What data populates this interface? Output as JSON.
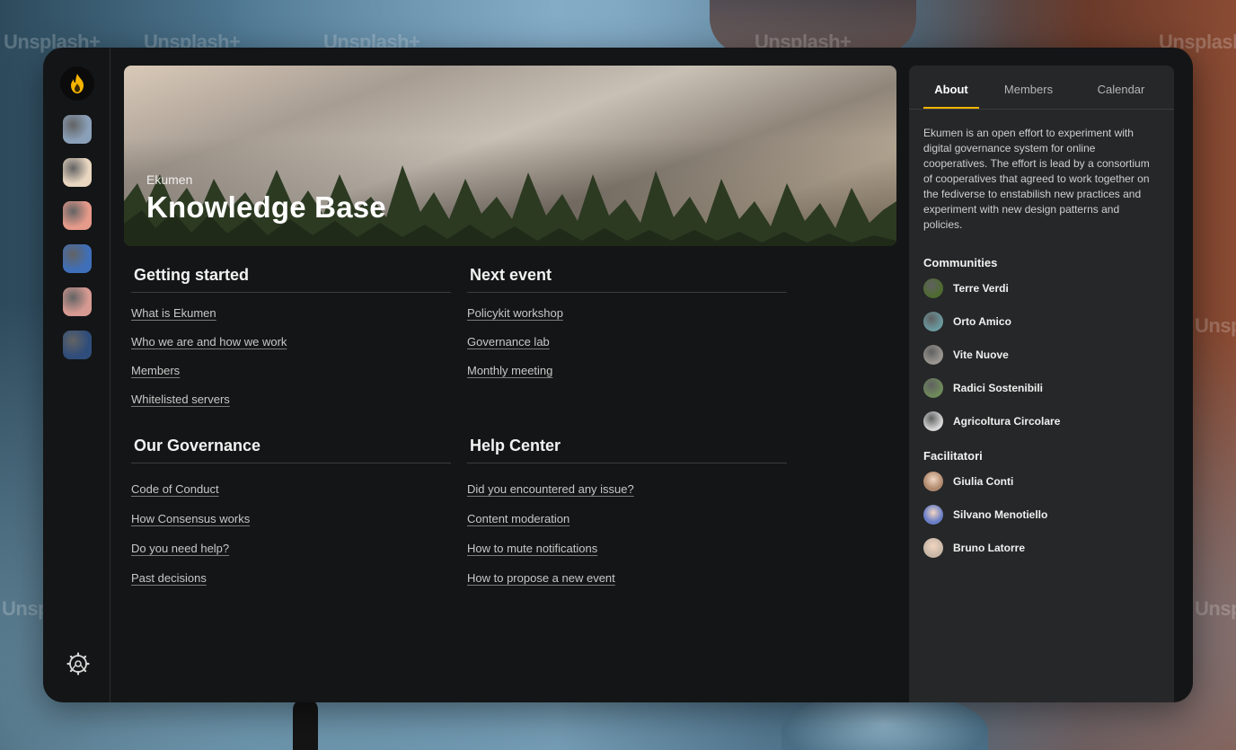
{
  "background": {
    "watermark": "Unsplash+"
  },
  "rail": {
    "logo_icon": "flame-icon",
    "items": [
      {
        "name": "community-1",
        "color": "#8aa0b8"
      },
      {
        "name": "community-2",
        "color": "#e8d6c0"
      },
      {
        "name": "community-3",
        "color": "#e59a8a"
      },
      {
        "name": "community-4",
        "color": "#3f6fb8"
      },
      {
        "name": "community-5",
        "color": "#d69a92"
      },
      {
        "name": "community-6",
        "color": "#2f4d7a"
      }
    ],
    "settings_icon": "gear-icon"
  },
  "hero": {
    "subtitle": "Ekumen",
    "title": "Knowledge Base"
  },
  "sections": [
    {
      "title": "Getting started",
      "links": [
        "What is Ekumen",
        "Who we are and how we work",
        "Members",
        "Whitelisted servers"
      ]
    },
    {
      "title": "Next event",
      "links": [
        "Policykit workshop",
        "Governance lab",
        "Monthly meeting"
      ]
    },
    {
      "title": "Our Governance",
      "links": [
        "Code of Conduct",
        "How Consensus works",
        "Do you need help?",
        "Past decisions"
      ]
    },
    {
      "title": "Help Center",
      "links": [
        "Did you encountered any issue?",
        "Content moderation",
        "How to mute notifications",
        "How to propose a new event"
      ]
    }
  ],
  "panel": {
    "tabs": [
      {
        "label": "About",
        "active": true
      },
      {
        "label": "Members",
        "active": false
      },
      {
        "label": "Calendar",
        "active": false
      }
    ],
    "about": "Ekumen is an open effort to experiment with digital governance system for online cooperatives. The effort is lead by a consortium of cooperatives that agreed to work together on the fediverse to enstabilish new practices and experiment with new design patterns and policies.",
    "communities_title": "Communities",
    "communities": [
      {
        "name": "Terre Verdi",
        "color": "#4e6b2f"
      },
      {
        "name": "Orto Amico",
        "color": "#6a9aa0"
      },
      {
        "name": "Vite Nuove",
        "color": "#9a9590"
      },
      {
        "name": "Radici Sostenibili",
        "color": "#6f8a5a"
      },
      {
        "name": "Agricoltura Circolare",
        "color": "#d8d8d8"
      }
    ],
    "facilitators_title": "Facilitatori",
    "facilitators": [
      {
        "name": "Giulia Conti",
        "color": "#b08a6e"
      },
      {
        "name": "Silvano Menotiello",
        "color": "#6a7fc8"
      },
      {
        "name": "Bruno Latorre",
        "color": "#c9b8a8"
      }
    ],
    "accent": "#f5b400"
  }
}
